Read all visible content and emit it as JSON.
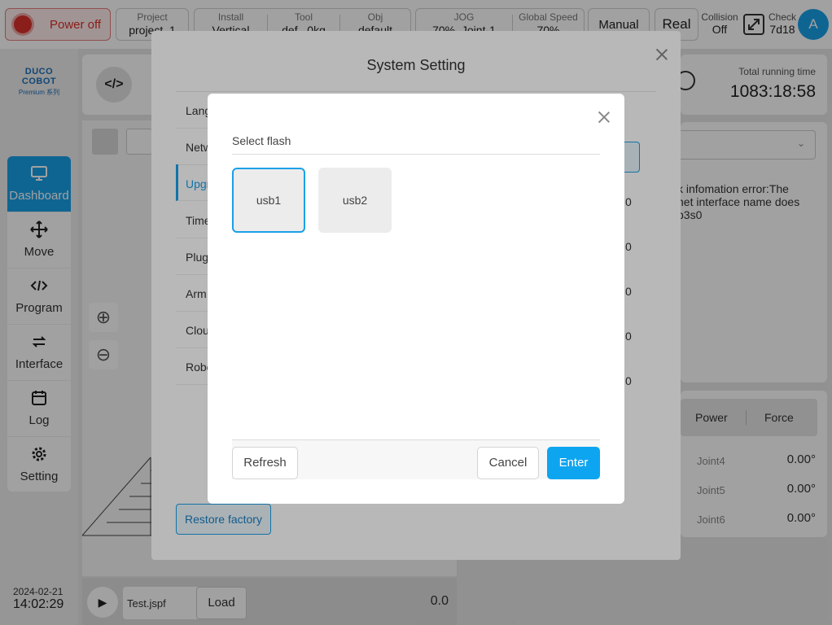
{
  "topbar": {
    "power_label": "Power off",
    "project": {
      "label": "Project",
      "value": "project_1"
    },
    "install": {
      "label": "Install",
      "value": "Vertical"
    },
    "tool": {
      "label": "Tool",
      "value": "def",
      "value2": "0kg"
    },
    "obj": {
      "label": "Obj",
      "value": "default"
    },
    "jog": {
      "label": "JOG",
      "value": "70%",
      "value2": "Joint-1"
    },
    "speed": {
      "label": "Global Speed",
      "value": "70%"
    },
    "manual_label": "Manual",
    "real_label": "Real",
    "collision": {
      "label": "Collision",
      "value": "Off"
    },
    "check": {
      "label": "Check",
      "value": "7d18"
    },
    "avatar": "A"
  },
  "logo": {
    "brand": "DUCO COBOT",
    "sub": "Premium 系列"
  },
  "sidebar": {
    "items": [
      {
        "label": "Dashboard",
        "icon": "monitor-icon"
      },
      {
        "label": "Move",
        "icon": "move-arrows-icon"
      },
      {
        "label": "Program",
        "icon": "code-icon"
      },
      {
        "label": "Interface",
        "icon": "swap-icon"
      },
      {
        "label": "Log",
        "icon": "calendar-icon"
      },
      {
        "label": "Setting",
        "icon": "gear-icon"
      }
    ],
    "date": "2024-02-21",
    "time": "14:02:29"
  },
  "dashboard": {
    "total_running_label": "Total running time",
    "total_running_value": "1083:18:58",
    "info_text": "k infomation error:The net interface name does p3s0",
    "col_values": [
      "0",
      "0",
      "0",
      "0",
      "0"
    ],
    "tabs": [
      "Power",
      "Force"
    ],
    "joints": [
      {
        "name": "Joint4",
        "value": "0.00°"
      },
      {
        "name": "Joint5",
        "value": "0.00°"
      },
      {
        "name": "Joint6",
        "value": "0.00°"
      }
    ],
    "file_name": "Test.jspf",
    "load_label": "Load",
    "progress_value": "0.0"
  },
  "system_setting": {
    "title": "System Setting",
    "menu": [
      "Lang",
      "Netw",
      "Upgr",
      "Time",
      "Plug",
      "Arm",
      "Clou",
      "Robo"
    ],
    "restore_label": "Restore factory"
  },
  "flash_dialog": {
    "title": "Select flash",
    "options": [
      "usb1",
      "usb2"
    ],
    "selected": "usb1",
    "refresh_label": "Refresh",
    "cancel_label": "Cancel",
    "enter_label": "Enter"
  },
  "colors": {
    "accent": "#1aa0e8",
    "power_red": "#d9302c"
  }
}
